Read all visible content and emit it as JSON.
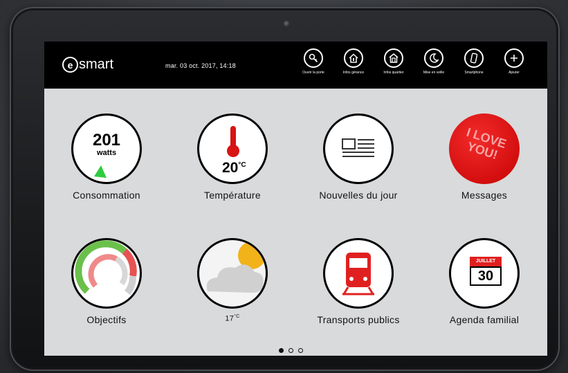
{
  "brand": {
    "logo_letter": "e",
    "logo_rest": "smart"
  },
  "datetime": "mar. 03 oct. 2017, 14:18",
  "nav": [
    {
      "label": "Ouvrir la porte",
      "icon": "key-icon"
    },
    {
      "label": "Infos gérance",
      "icon": "house-icon"
    },
    {
      "label": "Infos quartier",
      "icon": "building-icon"
    },
    {
      "label": "Mise en veille",
      "icon": "moon-icon"
    },
    {
      "label": "Smartphone",
      "icon": "smartphone-icon"
    },
    {
      "label": "Ajouter",
      "icon": "plus-icon"
    }
  ],
  "tiles": {
    "consommation": {
      "label": "Consommation",
      "value": "201",
      "unit": "watts"
    },
    "temperature": {
      "label": "Température",
      "value": "20",
      "unit": "°C"
    },
    "nouvelles": {
      "label": "Nouvelles du jour"
    },
    "messages": {
      "label": "Messages",
      "sticker_text": "I LOVE YOU!"
    },
    "objectifs": {
      "label": "Objectifs"
    },
    "meteo": {
      "label": "17",
      "unit": "°C"
    },
    "transports": {
      "label": "Transports publics"
    },
    "agenda": {
      "label": "Agenda familial",
      "month": "JUILLET",
      "day": "30"
    }
  },
  "pagination": {
    "current": 1,
    "total": 3
  },
  "colors": {
    "accent_red": "#e02020",
    "accent_green": "#2ecc40",
    "topbar": "#000000",
    "screen_bg": "#d9dadb"
  }
}
